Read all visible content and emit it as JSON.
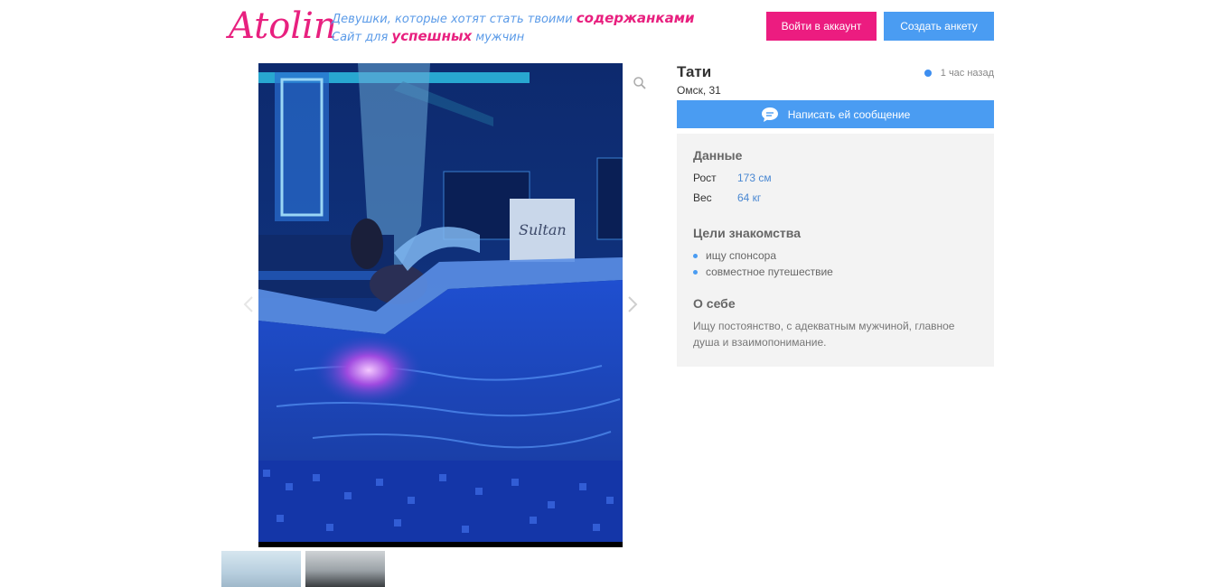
{
  "header": {
    "logo": "Atolin",
    "tagline_line1_prefix": "Девушки, которые хотят стать твоими",
    "tagline_line1_highlight": "содержанками",
    "tagline_line2_prefix": "Сайт для",
    "tagline_line2_highlight": "успешных",
    "tagline_line2_suffix": "мужчин",
    "login_label": "Войти в аккаунт",
    "create_label": "Создать анкету"
  },
  "gallery": {
    "zoom_icon": "zoom-icon",
    "prev_icon": "chevron-left-icon",
    "next_icon": "chevron-right-icon",
    "photo_sign": "Sultan"
  },
  "profile": {
    "name": "Тати",
    "city_age": "Омск, 31",
    "last_seen": "1 час назад",
    "message_label": "Написать ей сообщение",
    "data_title": "Данные",
    "height_label": "Рост",
    "height_value": "173 см",
    "weight_label": "Вес",
    "weight_value": "64 кг",
    "goals_title": "Цели знакомства",
    "goals": [
      "ищу спонсора",
      "совместное путешествие"
    ],
    "about_title": "О себе",
    "about_text": "Ищу постоянство, с адекватным мужчиной, главное душа и взаимопонимание."
  },
  "colors": {
    "brand_pink": "#ec1c80",
    "brand_blue": "#4a9cf2",
    "online_dot": "#3d8ef0"
  }
}
